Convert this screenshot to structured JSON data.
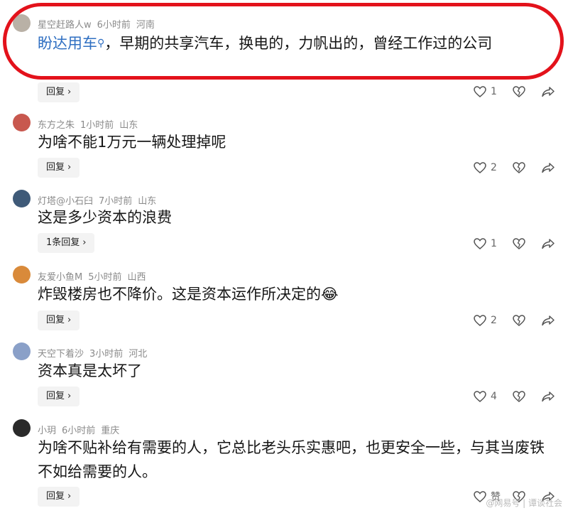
{
  "comments": [
    {
      "user": "星空赶路人w",
      "time": "6小时前",
      "location": "河南",
      "link_text": "盼达用车",
      "text": "，早期的共享汽车，换电的，力帆出的，曾经工作过的公司",
      "reply_label": "回复",
      "likes": "1"
    },
    {
      "user": "东方之朱",
      "time": "1小时前",
      "location": "山东",
      "text": "为啥不能1万元一辆处理掉呢",
      "reply_label": "回复",
      "likes": "2"
    },
    {
      "user": "灯塔@小石臼",
      "time": "7小时前",
      "location": "山东",
      "text": "这是多少资本的浪费",
      "reply_label": "1条回复",
      "likes": "1"
    },
    {
      "user": "友爱小鱼M",
      "time": "5小时前",
      "location": "山西",
      "text": "炸毁楼房也不降价。这是资本运作所决定的",
      "emoji": "😂",
      "reply_label": "回复",
      "likes": "2"
    },
    {
      "user": "天空下着沙",
      "time": "3小时前",
      "location": "河北",
      "text": "资本真是太坏了",
      "reply_label": "回复",
      "likes": "4"
    },
    {
      "user": "小玥",
      "time": "6小时前",
      "location": "重庆",
      "text": "为啥不贴补给有需要的人，它总比老头乐实惠吧，也更安全一些，与其当废铁不如给需要的人。",
      "reply_label": "回复",
      "likes": "赞"
    }
  ],
  "watermark": "@网易号 | 谭谈社会",
  "colors": {
    "link": "#2f6fc2",
    "highlight": "#e3121b",
    "meta": "#8a8a8a"
  },
  "icons": [
    "heart-outline-icon",
    "broken-heart-icon",
    "share-arrow-icon",
    "search-icon",
    "chevron-right-icon"
  ]
}
